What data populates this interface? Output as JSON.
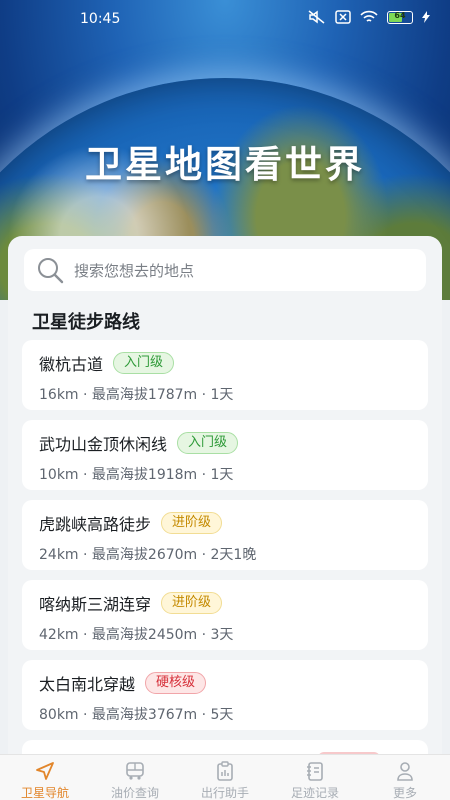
{
  "status_bar": {
    "time": "10:45",
    "battery_level": "64"
  },
  "hero": {
    "title": "卫星地图看世界"
  },
  "search": {
    "placeholder": "搜索您想去的地点"
  },
  "section": {
    "title": "卫星徒步路线"
  },
  "routes": [
    {
      "name": "徽杭古道",
      "level": "入门级",
      "meta": "16km · 最高海拔1787m · 1天"
    },
    {
      "name": "武功山金顶休闲线",
      "level": "入门级",
      "meta": "10km · 最高海拔1918m · 1天"
    },
    {
      "name": "虎跳峡高路徒步",
      "level": "进阶级",
      "meta": "24km · 最高海拔2670m · 2天1晚"
    },
    {
      "name": "喀纳斯三湖连穿",
      "level": "进阶级",
      "meta": "42km · 最高海拔2450m · 3天"
    },
    {
      "name": "太白南北穿越",
      "level": "硬核级",
      "meta": "80km · 最高海拔3767m · 5天"
    }
  ],
  "tabs": [
    {
      "label": "卫星导航",
      "icon": "navigation-arrow-icon",
      "active": true
    },
    {
      "label": "油价查询",
      "icon": "bus-icon",
      "active": false
    },
    {
      "label": "出行助手",
      "icon": "clipboard-icon",
      "active": false
    },
    {
      "label": "足迹记录",
      "icon": "notebook-icon",
      "active": false
    },
    {
      "label": "更多",
      "icon": "user-icon",
      "active": false
    }
  ],
  "colors": {
    "accent": "#e2862b",
    "entry_badge": "#2e9a38",
    "advanced_badge": "#c48a00",
    "hardcore_badge": "#d6303a"
  }
}
